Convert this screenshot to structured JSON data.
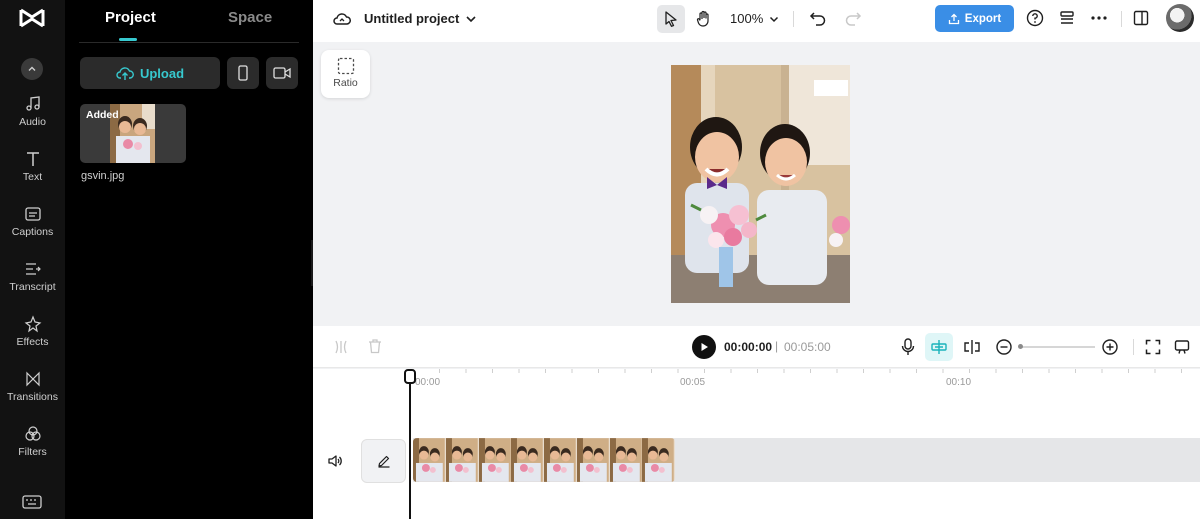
{
  "nav": {
    "items": [
      {
        "label": "Audio",
        "icon": "music-note-icon"
      },
      {
        "label": "Text",
        "icon": "text-icon"
      },
      {
        "label": "Captions",
        "icon": "captions-icon"
      },
      {
        "label": "Transcript",
        "icon": "transcript-icon"
      },
      {
        "label": "Effects",
        "icon": "effects-icon"
      },
      {
        "label": "Transitions",
        "icon": "transitions-icon"
      },
      {
        "label": "Filters",
        "icon": "filters-icon"
      }
    ]
  },
  "panel": {
    "tabs": [
      {
        "label": "Project",
        "active": true
      },
      {
        "label": "Space",
        "active": false
      }
    ],
    "upload_label": "Upload",
    "media": [
      {
        "name": "gsvin.jpg",
        "badge": "Added"
      }
    ]
  },
  "header": {
    "project_title": "Untitled project",
    "zoom": "100%",
    "export_label": "Export"
  },
  "canvas": {
    "ratio_label": "Ratio"
  },
  "player": {
    "current_time": "00:00:00",
    "separator": "|",
    "total_time": "00:05:00"
  },
  "timeline": {
    "ruler_labels": [
      "00:00",
      "00:05",
      "00:10"
    ]
  },
  "colors": {
    "accent": "#37c9cf",
    "export": "#3a8ee6",
    "rail_bg": "#121212",
    "panel_bg": "#000000"
  }
}
